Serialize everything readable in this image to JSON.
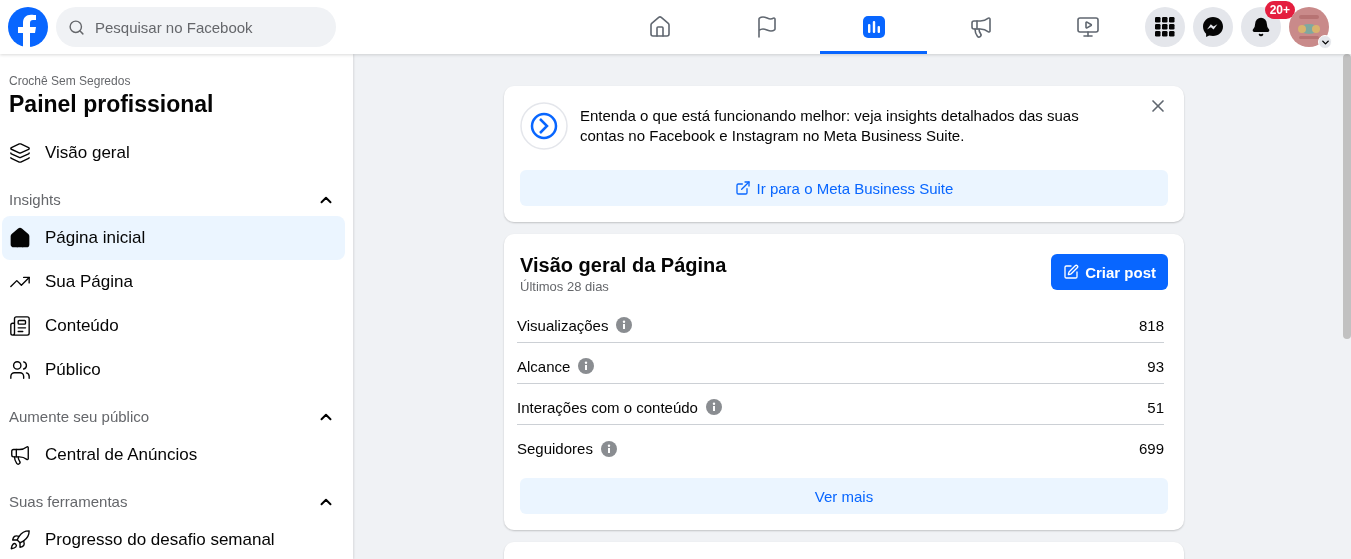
{
  "search": {
    "placeholder": "Pesquisar no Facebook"
  },
  "nav_tabs": [
    {
      "selected": false
    },
    {
      "selected": false
    },
    {
      "selected": true
    },
    {
      "selected": false
    },
    {
      "selected": false
    }
  ],
  "notifications": {
    "badge": "20+"
  },
  "sidebar": {
    "page_name": "Crochê Sem Segredos",
    "title": "Painel profissional",
    "sections": [
      {
        "items": [
          {
            "label": "Visão geral",
            "selected": false
          }
        ]
      },
      {
        "title": "Insights",
        "expanded": true,
        "items": [
          {
            "label": "Página inicial",
            "selected": true
          },
          {
            "label": "Sua Página",
            "selected": false
          },
          {
            "label": "Conteúdo",
            "selected": false
          },
          {
            "label": "Público",
            "selected": false
          }
        ]
      },
      {
        "title": "Aumente seu público",
        "expanded": true,
        "items": [
          {
            "label": "Central de Anúncios",
            "selected": false
          }
        ]
      },
      {
        "title": "Suas ferramentas",
        "expanded": true,
        "items": [
          {
            "label": "Progresso do desafio semanal",
            "selected": false
          }
        ]
      }
    ]
  },
  "promo": {
    "text": "Entenda o que está funcionando melhor: veja insights detalhados das suas contas no Facebook e Instagram no Meta Business Suite.",
    "button": "Ir para o Meta Business Suite"
  },
  "overview": {
    "title": "Visão geral da Página",
    "subtitle": "Últimos 28 dias",
    "button": "Criar post",
    "metrics": [
      {
        "label": "Visualizações",
        "value": "818"
      },
      {
        "label": "Alcance",
        "value": "93"
      },
      {
        "label": "Interações com o conteúdo",
        "value": "51"
      },
      {
        "label": "Seguidores",
        "value": "699"
      }
    ],
    "more": "Ver mais"
  }
}
